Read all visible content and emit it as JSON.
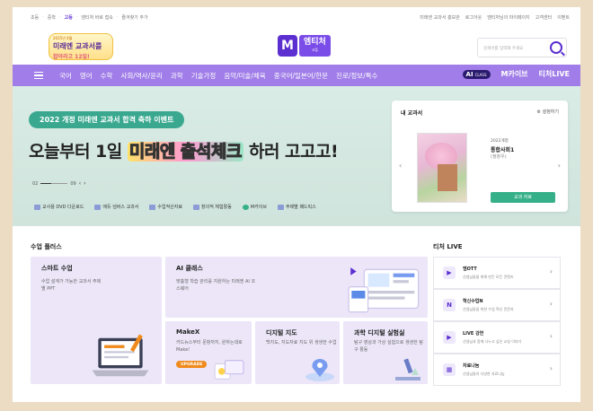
{
  "topbar": {
    "left": [
      "초등",
      "중학",
      "고등",
      "엠티처 바로 접속",
      "즐겨찾기 추가"
    ],
    "active_index": 2,
    "right": [
      "미래엔 교과서 홍보관",
      "로그아웃",
      "엠티처님의 마이페이지",
      "고객센터",
      "이벤트"
    ]
  },
  "promo": {
    "tag": "2025년 4월",
    "main": "미래엔 교과서를",
    "sub": "잡아라고 12일!"
  },
  "logo": {
    "m": "M",
    "name": "엠티처",
    "grade": "고등"
  },
  "search": {
    "placeholder": "검색어를 입력해 주세요"
  },
  "nav": {
    "items": [
      "국어",
      "영어",
      "수학",
      "사회/역사/윤리",
      "과학",
      "기술가정",
      "음악/미술/체육",
      "중국어/일본어/한문",
      "진로/정보/특수"
    ],
    "ai": "AI",
    "ai_sub": "CLASS",
    "mcave": "M카이브",
    "teacher_live": "티처LIVE"
  },
  "banner": {
    "title": "2022 개정 미래엔 교과서 합격 축하 이벤트",
    "main_a": "오늘부터 1일 ",
    "main_hl": "미래엔 출석체크",
    "main_b": " 하러 고고고!",
    "page_current": "02",
    "page_total": "09"
  },
  "quick_links": [
    "교사용 DVD 다운로드",
    "에듀 넘버스 교과서",
    "수업적산자료",
    "창의적 체험활동",
    "M카이브",
    "주제별 패드릭스"
  ],
  "my_textbook": {
    "heading": "내 교과서",
    "settings": "설정하기",
    "year": "2022개정",
    "name": "통합사회1",
    "author": "(정창우)",
    "button": "교과 자료"
  },
  "class_plus": {
    "title": "수업 플러스",
    "tiles": [
      {
        "title": "스마트 수업",
        "desc": "수업 설계가 가능한 교과서 주제별 PPT"
      },
      {
        "title": "AI 클래스",
        "desc": "맞춤형 학습 관리를 지원하는 미래엔 AI 코스웨어"
      },
      {
        "title": "MakeX",
        "desc": "카드뉴스부터 문항까지, 원하는대로 Make!",
        "badge": "UPGRADE"
      },
      {
        "title": "디지털 지도",
        "desc": "백지도, 지도자료 지도 위 생생한 수업"
      },
      {
        "title": "과학 디지털 실험실",
        "desc": "탐구 영상과 가상 실험으로 생생한 탐구 활동"
      }
    ]
  },
  "teacher_live": {
    "title": "티처 LIVE",
    "items": [
      {
        "icon": "▶",
        "name": "엠OTT",
        "desc": "선생님들을 위해 만든 모든 콘텐츠"
      },
      {
        "icon": "N",
        "name": "혁신수업N",
        "desc": "선생님들을 위한 수업 혁신 전문지"
      },
      {
        "icon": "▶",
        "name": "LIVE 강연",
        "desc": "선생님과 함께 나누고 싶은 교실 이야기"
      },
      {
        "icon": "▦",
        "name": "자료나눔",
        "desc": "선생님들의 다양한 자료나눔"
      }
    ]
  },
  "colors": {
    "brand": "#5b2fd0",
    "nav": "#a07de8",
    "hero_bg": "#d9ece6",
    "accent_green": "#35b089"
  }
}
